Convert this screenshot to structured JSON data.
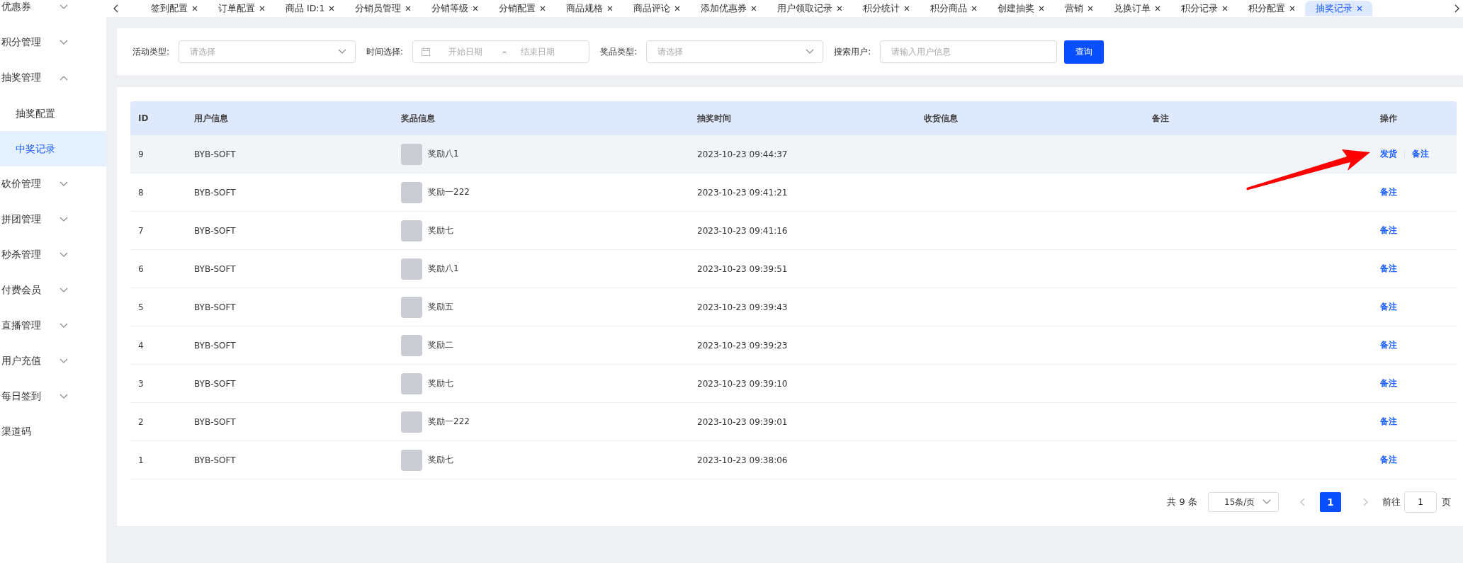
{
  "sidebar": {
    "items": [
      {
        "label": "优惠券",
        "expanded": false
      },
      {
        "label": "积分管理",
        "expanded": false
      },
      {
        "label": "抽奖管理",
        "expanded": true,
        "children": [
          {
            "label": "抽奖配置",
            "selected": false
          },
          {
            "label": "中奖记录",
            "selected": true
          }
        ]
      },
      {
        "label": "砍价管理",
        "expanded": false
      },
      {
        "label": "拼团管理",
        "expanded": false
      },
      {
        "label": "秒杀管理",
        "expanded": false
      },
      {
        "label": "付费会员",
        "expanded": false
      },
      {
        "label": "直播管理",
        "expanded": false
      },
      {
        "label": "用户充值",
        "expanded": false
      },
      {
        "label": "每日签到",
        "expanded": false
      },
      {
        "label": "渠道码"
      }
    ]
  },
  "tabs": [
    {
      "label": "签到配置",
      "selected": false
    },
    {
      "label": "订单配置",
      "selected": false
    },
    {
      "label": "商品 ID:1",
      "selected": false
    },
    {
      "label": "分销员管理",
      "selected": false
    },
    {
      "label": "分销等级",
      "selected": false
    },
    {
      "label": "分销配置",
      "selected": false
    },
    {
      "label": "商品规格",
      "selected": false
    },
    {
      "label": "商品评论",
      "selected": false
    },
    {
      "label": "添加优惠券",
      "selected": false
    },
    {
      "label": "用户领取记录",
      "selected": false
    },
    {
      "label": "积分统计",
      "selected": false
    },
    {
      "label": "积分商品",
      "selected": false
    },
    {
      "label": "创建抽奖",
      "selected": false
    },
    {
      "label": "营销",
      "selected": false
    },
    {
      "label": "兑换订单",
      "selected": false
    },
    {
      "label": "积分记录",
      "selected": false
    },
    {
      "label": "积分配置",
      "selected": false
    },
    {
      "label": "抽奖记录",
      "selected": true
    }
  ],
  "filters": [
    {
      "kind": "select",
      "label": "活动类型:",
      "placeholder": "请选择"
    },
    {
      "kind": "daterange",
      "label": "时间选择:",
      "start_placeholder": "开始日期",
      "separator": "–",
      "end_placeholder": "结束日期"
    },
    {
      "kind": "select",
      "label": "奖品类型:",
      "placeholder": "请选择"
    },
    {
      "kind": "input",
      "label": "搜索用户:",
      "placeholder": "请输入用户信息"
    }
  ],
  "search_button": "查询",
  "table": {
    "columns": [
      "ID",
      "用户信息",
      "奖品信息",
      "抽奖时间",
      "收货信息",
      "备注",
      "操作"
    ],
    "rows": [
      {
        "id": "9",
        "user": "BYB-SOFT",
        "prize": "奖励八1",
        "time": "2023-10-23 09:44:37",
        "highlighted": true,
        "actions": [
          "发货",
          "备注"
        ]
      },
      {
        "id": "8",
        "user": "BYB-SOFT",
        "prize": "奖励一222",
        "time": "2023-10-23 09:41:21",
        "highlighted": false,
        "actions": [
          "备注"
        ]
      },
      {
        "id": "7",
        "user": "BYB-SOFT",
        "prize": "奖励七",
        "time": "2023-10-23 09:41:16",
        "highlighted": false,
        "actions": [
          "备注"
        ]
      },
      {
        "id": "6",
        "user": "BYB-SOFT",
        "prize": "奖励八1",
        "time": "2023-10-23 09:39:51",
        "highlighted": false,
        "actions": [
          "备注"
        ]
      },
      {
        "id": "5",
        "user": "BYB-SOFT",
        "prize": "奖励五",
        "time": "2023-10-23 09:39:43",
        "highlighted": false,
        "actions": [
          "备注"
        ]
      },
      {
        "id": "4",
        "user": "BYB-SOFT",
        "prize": "奖励二",
        "time": "2023-10-23 09:39:23",
        "highlighted": false,
        "actions": [
          "备注"
        ]
      },
      {
        "id": "3",
        "user": "BYB-SOFT",
        "prize": "奖励七",
        "time": "2023-10-23 09:39:10",
        "highlighted": false,
        "actions": [
          "备注"
        ]
      },
      {
        "id": "2",
        "user": "BYB-SOFT",
        "prize": "奖励一222",
        "time": "2023-10-23 09:39:01",
        "highlighted": false,
        "actions": [
          "备注"
        ]
      },
      {
        "id": "1",
        "user": "BYB-SOFT",
        "prize": "奖励七",
        "time": "2023-10-23 09:38:06",
        "highlighted": false,
        "actions": [
          "备注"
        ]
      }
    ]
  },
  "pagination": {
    "total": "共 9 条",
    "page_size": "15条/页",
    "pages": [
      {
        "label": "1",
        "selected": true
      }
    ],
    "goto_label": "前往",
    "goto_value": "1",
    "goto_suffix": "页"
  }
}
